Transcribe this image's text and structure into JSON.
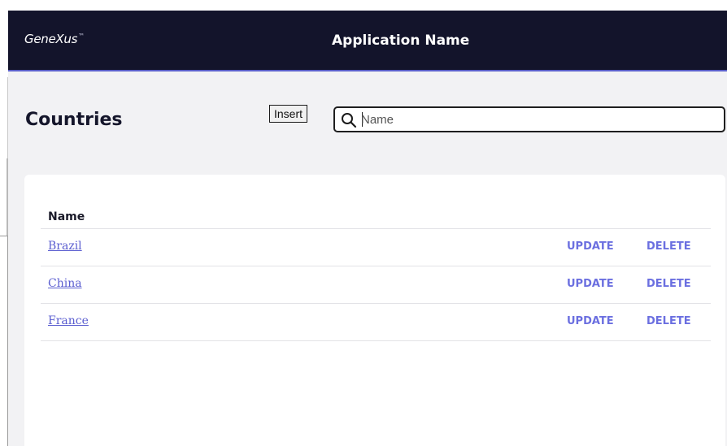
{
  "header": {
    "logo": "GeneXus",
    "logo_mark": "™",
    "app_name": "Application Name",
    "background_color": "#13142b",
    "accent_color": "#5a5fc9"
  },
  "page": {
    "title": "Countries",
    "insert_label": "Insert",
    "search": {
      "icon": "search-icon",
      "placeholder": "Name",
      "value": ""
    }
  },
  "grid": {
    "columns": [
      "Name"
    ],
    "rows": [
      {
        "name": "Brazil",
        "update": "UPDATE",
        "delete": "DELETE"
      },
      {
        "name": "China",
        "update": "UPDATE",
        "delete": "DELETE"
      },
      {
        "name": "France",
        "update": "UPDATE",
        "delete": "DELETE"
      }
    ],
    "link_color": "#5b5ed0",
    "action_color": "#6b6fe0"
  }
}
